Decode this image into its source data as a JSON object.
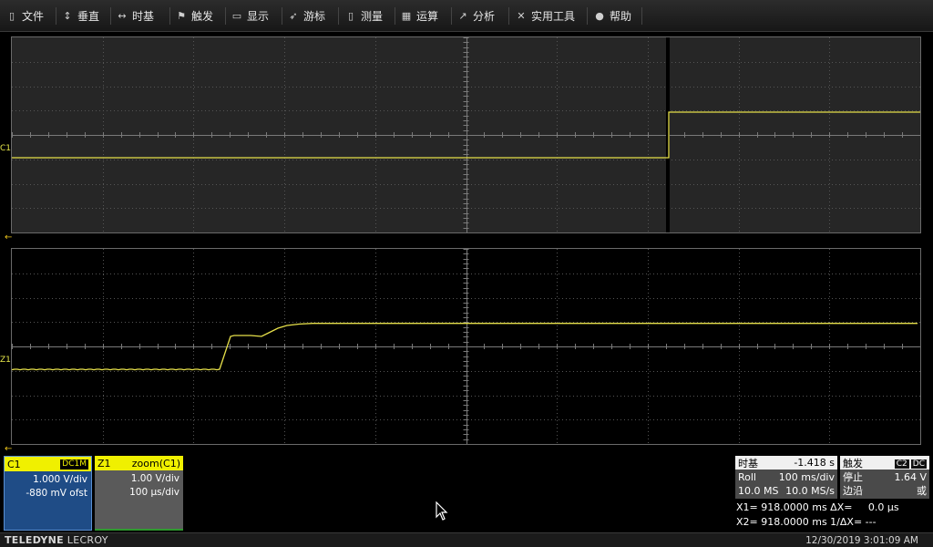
{
  "menu": [
    {
      "label": "文件",
      "icon": "document-icon",
      "glyph": "▯"
    },
    {
      "label": "垂直",
      "icon": "vertical-arrows-icon",
      "glyph": "↕"
    },
    {
      "label": "时基",
      "icon": "horizontal-arrows-icon",
      "glyph": "↔"
    },
    {
      "label": "触发",
      "icon": "trigger-flag-icon",
      "glyph": "⚑"
    },
    {
      "label": "显示",
      "icon": "display-icon",
      "glyph": "▭"
    },
    {
      "label": "游标",
      "icon": "cursor-pointer-icon",
      "glyph": "➶"
    },
    {
      "label": "测量",
      "icon": "ruler-icon",
      "glyph": "▯"
    },
    {
      "label": "运算",
      "icon": "calculator-icon",
      "glyph": "▦"
    },
    {
      "label": "分析",
      "icon": "chart-icon",
      "glyph": "↗"
    },
    {
      "label": "实用工具",
      "icon": "tools-icon",
      "glyph": "✕"
    },
    {
      "label": "帮助",
      "icon": "help-icon",
      "glyph": "●"
    }
  ],
  "grids": {
    "top_marker": "C1",
    "bottom_marker": "Z1",
    "arrow": "←"
  },
  "channels": {
    "c1": {
      "name": "C1",
      "coupling": "DC1M",
      "scale": "1.000 V/div",
      "offset": "-880 mV ofst"
    },
    "z1": {
      "name": "Z1",
      "source": "zoom(C1)",
      "scale": "1.00 V/div",
      "timebase": "100 µs/div"
    }
  },
  "timebase": {
    "label": "时基",
    "delay": "-1.418 s",
    "mode": "Roll",
    "time_div": "100 ms/div",
    "samples": "10.0 MS",
    "sample_rate": "10.0 MS/s"
  },
  "trigger": {
    "label": "触发",
    "source": "C2",
    "coupling": "DC",
    "state": "停止",
    "level": "1.64 V",
    "type": "边沿",
    "slope": "或"
  },
  "cursor_readout": {
    "line1": "X1= 918.0000 ms ΔX=     0.0 µs",
    "line2": "X2= 918.0000 ms 1/ΔX= ---"
  },
  "status": {
    "brand_bold": "TELEDYNE",
    "brand_rest": " LECROY",
    "datetime": "12/30/2019 3:01:09 AM"
  },
  "colors": {
    "trace": "#e6e04a",
    "c1_box": "#1f4c86",
    "grid_top_bg": "#262626"
  }
}
